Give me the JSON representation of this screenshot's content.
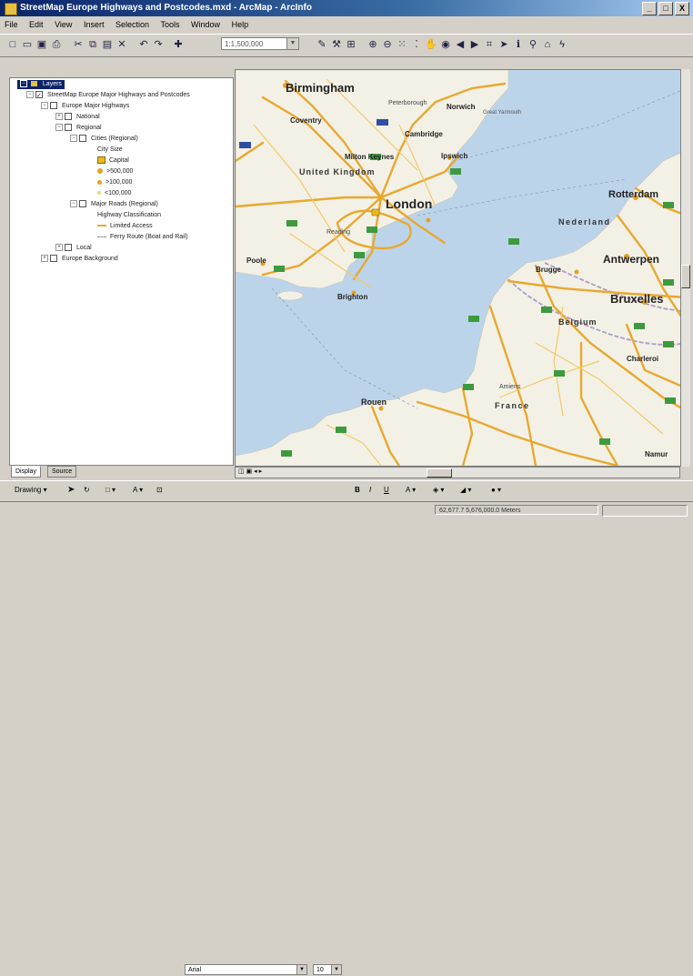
{
  "window": {
    "title": "StreetMap Europe Highways and Postcodes.mxd - ArcMap - ArcInfo",
    "controls": [
      "_",
      "□",
      "X"
    ]
  },
  "menu": [
    "File",
    "Edit",
    "View",
    "Insert",
    "Selection",
    "Tools",
    "Window",
    "Help"
  ],
  "toolbar": {
    "scale_value": "1:1,500,000"
  },
  "toc": {
    "rows": [
      {
        "label": "Layers",
        "indent": 0,
        "selected": true,
        "expand": "-",
        "checkbox": false,
        "symbol": "layers"
      },
      {
        "label": "StreetMap Europe Major Highways and Postcodes",
        "indent": 1,
        "expand": "-",
        "checkbox": true
      },
      {
        "label": "Europe Major Highways",
        "indent": 2,
        "expand": "-",
        "checkbox": true
      },
      {
        "label": "National",
        "indent": 3,
        "expand": "+",
        "checkbox": true
      },
      {
        "label": "Regional",
        "indent": 3,
        "expand": "-",
        "checkbox": true
      },
      {
        "label": "Cities (Regional)",
        "indent": 4,
        "expand": "-",
        "checkbox": true
      },
      {
        "label": "City Size",
        "indent": 5
      },
      {
        "label": "Capital",
        "indent": 5,
        "symbol": "capital"
      },
      {
        "label": ">500,000",
        "indent": 5,
        "symbol": "dot-large"
      },
      {
        "label": ">100,000",
        "indent": 5,
        "symbol": "dot-med"
      },
      {
        "label": "<100,000",
        "indent": 5,
        "symbol": "dot-small"
      },
      {
        "label": "Major Roads (Regional)",
        "indent": 4,
        "expand": "-",
        "checkbox": true
      },
      {
        "label": "Highway Classification",
        "indent": 5
      },
      {
        "label": "Limited Access",
        "indent": 5,
        "symbol": "line-orange"
      },
      {
        "label": "Ferry Route (Boat and Rail)",
        "indent": 5,
        "symbol": "line-dash"
      },
      {
        "label": "Local",
        "indent": 3,
        "expand": "+",
        "checkbox": true
      },
      {
        "label": "Europe Background",
        "indent": 2,
        "expand": "+",
        "checkbox": true
      }
    ],
    "tabs": [
      "Display",
      "Source"
    ]
  },
  "map": {
    "colors": {
      "sea": "#bcd4ea",
      "land": "#f3f1e6",
      "road_major": "#e8a830",
      "road_minor": "#f3c968",
      "border": "#b09acb",
      "shield": "#3e9a3e",
      "shield_blue": "#2f4fa3"
    },
    "labels": [
      {
        "text": "Birmingham",
        "size": "xl"
      },
      {
        "text": "Peterborough",
        "size": "s"
      },
      {
        "text": "Norwich",
        "size": "m"
      },
      {
        "text": "Great Yarmouth",
        "size": "s"
      },
      {
        "text": "Coventry",
        "size": "m"
      },
      {
        "text": "Cambridge",
        "size": "m"
      },
      {
        "text": "Milton Keynes",
        "size": "m"
      },
      {
        "text": "Ipswich",
        "size": "m"
      },
      {
        "text": "United Kingdom",
        "size": "l"
      },
      {
        "text": "London",
        "size": "xl"
      },
      {
        "text": "Rotterdam",
        "size": "l"
      },
      {
        "text": "Nederland",
        "size": "l"
      },
      {
        "text": "Antwerpen",
        "size": "l"
      },
      {
        "text": "Brugge",
        "size": "m"
      },
      {
        "text": "Bruxelles",
        "size": "xl"
      },
      {
        "text": "Belgium",
        "size": "l"
      },
      {
        "text": "Charleroi",
        "size": "m"
      },
      {
        "text": "Brighton",
        "size": "m"
      },
      {
        "text": "Reading",
        "size": "m"
      },
      {
        "text": "Poole",
        "size": "m"
      },
      {
        "text": "Rouen",
        "size": "m"
      },
      {
        "text": "France",
        "size": "l"
      },
      {
        "text": "Amiens",
        "size": "s"
      },
      {
        "text": "Namur",
        "size": "m"
      }
    ]
  },
  "drawing": {
    "label": "Drawing",
    "font": "Arial",
    "size": "10",
    "format_buttons": [
      "B",
      "I",
      "U"
    ]
  },
  "status": {
    "coordinates": "62,677.7 5,676,000.0 Meters"
  }
}
